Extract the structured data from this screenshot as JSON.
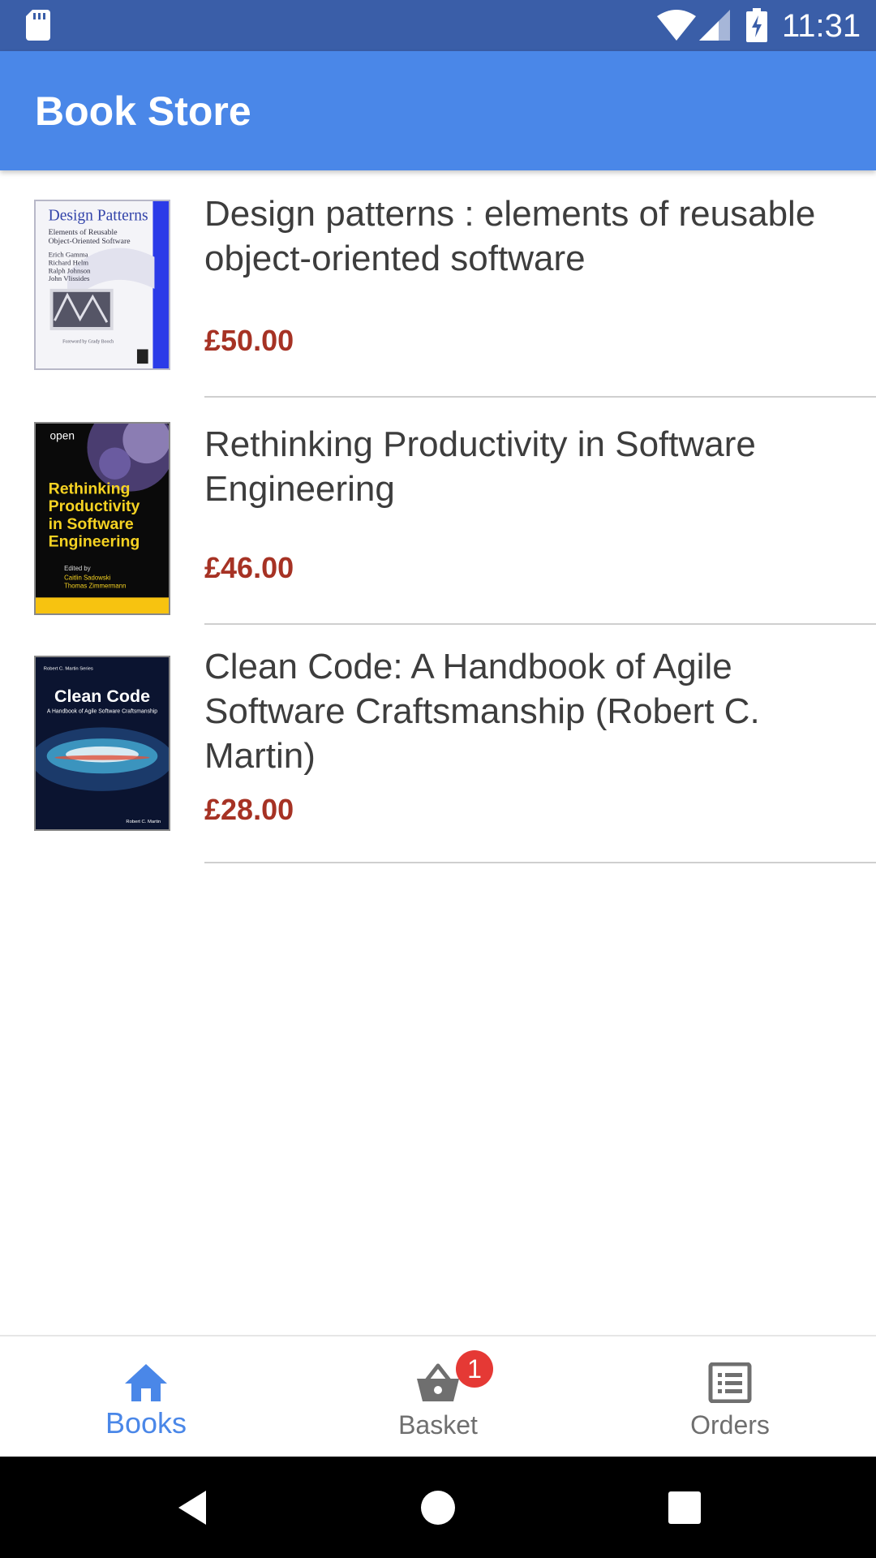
{
  "status_bar": {
    "time": "11:31",
    "icons": [
      "sd-card-icon",
      "wifi-icon",
      "signal-icon",
      "battery-charging-icon"
    ],
    "color": "#3a5ea8"
  },
  "app_bar": {
    "title": "Book Store",
    "color": "#4a87e8"
  },
  "books": [
    {
      "title": "Design patterns : elements of reusable object-oriented software",
      "price": "£50.00",
      "cover": {
        "heading": "Design Patterns",
        "subtitle_lines": [
          "Elements of Reusable",
          "Object-Oriented Software"
        ],
        "authors": [
          "Erich Gamma",
          "Richard Helm",
          "Ralph Johnson",
          "John Vlissides"
        ],
        "foreword": "Foreword by Grady Booch"
      }
    },
    {
      "title": "Rethinking Productivity in Software Engineering",
      "price": "£46.00",
      "cover": {
        "publisher": "open",
        "heading_lines": [
          "Rethinking",
          "Productivity",
          "in Software",
          "Engineering"
        ],
        "editors_label": "Edited by",
        "editors": [
          "Caitlin Sadowski",
          "Thomas Zimmermann"
        ]
      }
    },
    {
      "title": "Clean Code: A Handbook of Agile Software Craftsmanship (Robert C. Martin)",
      "price": "£28.00",
      "cover": {
        "series": "Robert C. Martin Series",
        "heading": "Clean Code",
        "subtitle": "A Handbook of Agile Software Craftsmanship",
        "author": "Robert C. Martin"
      }
    }
  ],
  "colors": {
    "price": "#a63224",
    "active_tab": "#4a87e8",
    "inactive_tab": "#6f6f6f",
    "badge": "#e53935"
  },
  "bottom_nav": {
    "tabs": [
      {
        "label": "Books",
        "icon": "home-icon",
        "active": true
      },
      {
        "label": "Basket",
        "icon": "basket-icon",
        "active": false
      },
      {
        "label": "Orders",
        "icon": "orders-list-icon",
        "active": false
      }
    ],
    "basket_badge": "1"
  },
  "system_nav": {
    "buttons": [
      "back-icon",
      "home-circle-icon",
      "recents-icon"
    ]
  }
}
